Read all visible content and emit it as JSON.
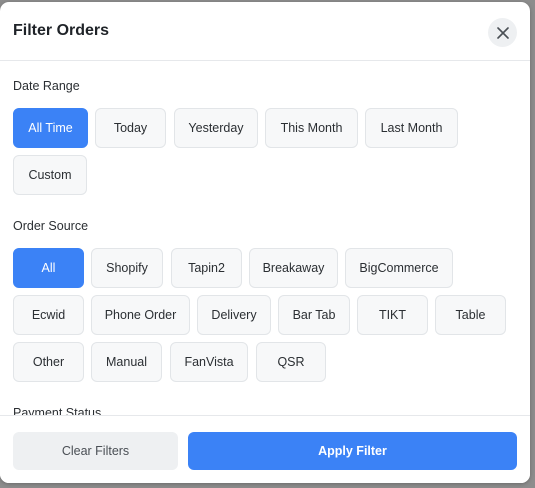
{
  "modal": {
    "title": "Filter Orders",
    "close_icon": "close-icon"
  },
  "date_range": {
    "label": "Date Range",
    "options": [
      "All Time",
      "Today",
      "Yesterday",
      "This Month",
      "Last Month",
      "Custom"
    ],
    "selected": "All Time"
  },
  "order_source": {
    "label": "Order Source",
    "options": [
      "All",
      "Shopify",
      "Tapin2",
      "Breakaway",
      "BigCommerce",
      "Ecwid",
      "Phone Order",
      "Delivery",
      "Bar Tab",
      "TIKT",
      "Table",
      "Other",
      "Manual",
      "FanVista",
      "QSR"
    ],
    "selected": "All"
  },
  "payment_status": {
    "label": "Payment Status"
  },
  "footer": {
    "clear_label": "Clear Filters",
    "apply_label": "Apply Filter"
  },
  "colors": {
    "accent": "#3b82f6",
    "chip_bg": "#f7f8f9",
    "chip_border": "#e2e5e8",
    "text": "#1f2328"
  }
}
